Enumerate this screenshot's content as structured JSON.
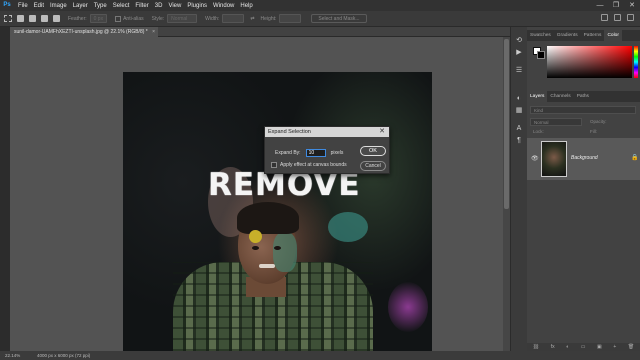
{
  "app": {
    "logo": "Ps"
  },
  "menu": [
    "File",
    "Edit",
    "Image",
    "Layer",
    "Type",
    "Select",
    "Filter",
    "3D",
    "View",
    "Plugins",
    "Window",
    "Help"
  ],
  "window_controls": [
    "—",
    "❐",
    "✕"
  ],
  "options_bar": {
    "feather_label": "Feather:",
    "feather_value": "0 px",
    "anti_alias_label": "Anti-alias",
    "style_label": "Style:",
    "style_value": "Normal",
    "width_label": "Width:",
    "height_label": "Height:",
    "select_mask_label": "Select and Mask..."
  },
  "document_tab": {
    "title": "sunil-damor-UAMFhXEZTI-unsplash.jpg @ 22.1% (RGB/8) *",
    "close": "×"
  },
  "canvas": {
    "overlay_text": "REMOVE"
  },
  "dialog": {
    "title": "Expand Selection",
    "close": "✕",
    "expand_label": "Expand By:",
    "expand_value": "10",
    "unit": "pixels",
    "apply_label": "Apply effect at canvas bounds",
    "ok_label": "OK",
    "cancel_label": "Cancel"
  },
  "status": {
    "zoom": "22.14%",
    "info": "4000 px x 6000 px (72 ppi)"
  },
  "panels": {
    "top_tabs": [
      "Swatches",
      "Gradients",
      "Patterns",
      "Color"
    ],
    "top_active": "Color",
    "layer_tabs": [
      "Layers",
      "Channels",
      "Paths"
    ],
    "layer_active": "Layers",
    "kind_label": "Kind",
    "blend_mode": "Normal",
    "opacity_label": "Opacity:",
    "lock_label": "Lock:",
    "fill_label": "Fill:",
    "layer_name": "Background",
    "bottom_icons": [
      "⛓",
      "fx",
      "◐",
      "▭",
      "▣",
      "+",
      "🗑"
    ]
  },
  "colors": {
    "accent": "#31a8ff",
    "foreground": "#ffffff",
    "background": "#000000"
  }
}
